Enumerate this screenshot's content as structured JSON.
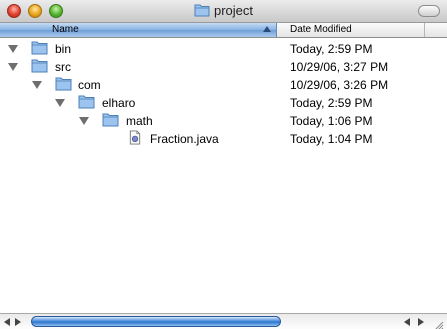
{
  "window": {
    "title": "project"
  },
  "header": {
    "name_label": "Name",
    "date_label": "Date Modified"
  },
  "rows": [
    {
      "name": "bin",
      "date": "Today, 2:59 PM",
      "type": "folder",
      "expanded": true,
      "depth": 0
    },
    {
      "name": "src",
      "date": "10/29/06, 3:27 PM",
      "type": "folder",
      "expanded": true,
      "depth": 0
    },
    {
      "name": "com",
      "date": "10/29/06, 3:26 PM",
      "type": "folder",
      "expanded": true,
      "depth": 1
    },
    {
      "name": "elharo",
      "date": "Today, 2:59 PM",
      "type": "folder",
      "expanded": true,
      "depth": 2
    },
    {
      "name": "math",
      "date": "Today, 1:06 PM",
      "type": "folder",
      "expanded": true,
      "depth": 3
    },
    {
      "name": "Fraction.java",
      "date": "Today, 1:04 PM",
      "type": "java-file",
      "expanded": false,
      "depth": 4
    }
  ],
  "icons": {
    "folder": "folder-icon",
    "file": "java-file-icon",
    "disclosure": "disclosure-triangle-icon"
  },
  "colors": {
    "header_accent": "#86b2e3",
    "scroll_thumb": "#2f73c9"
  }
}
